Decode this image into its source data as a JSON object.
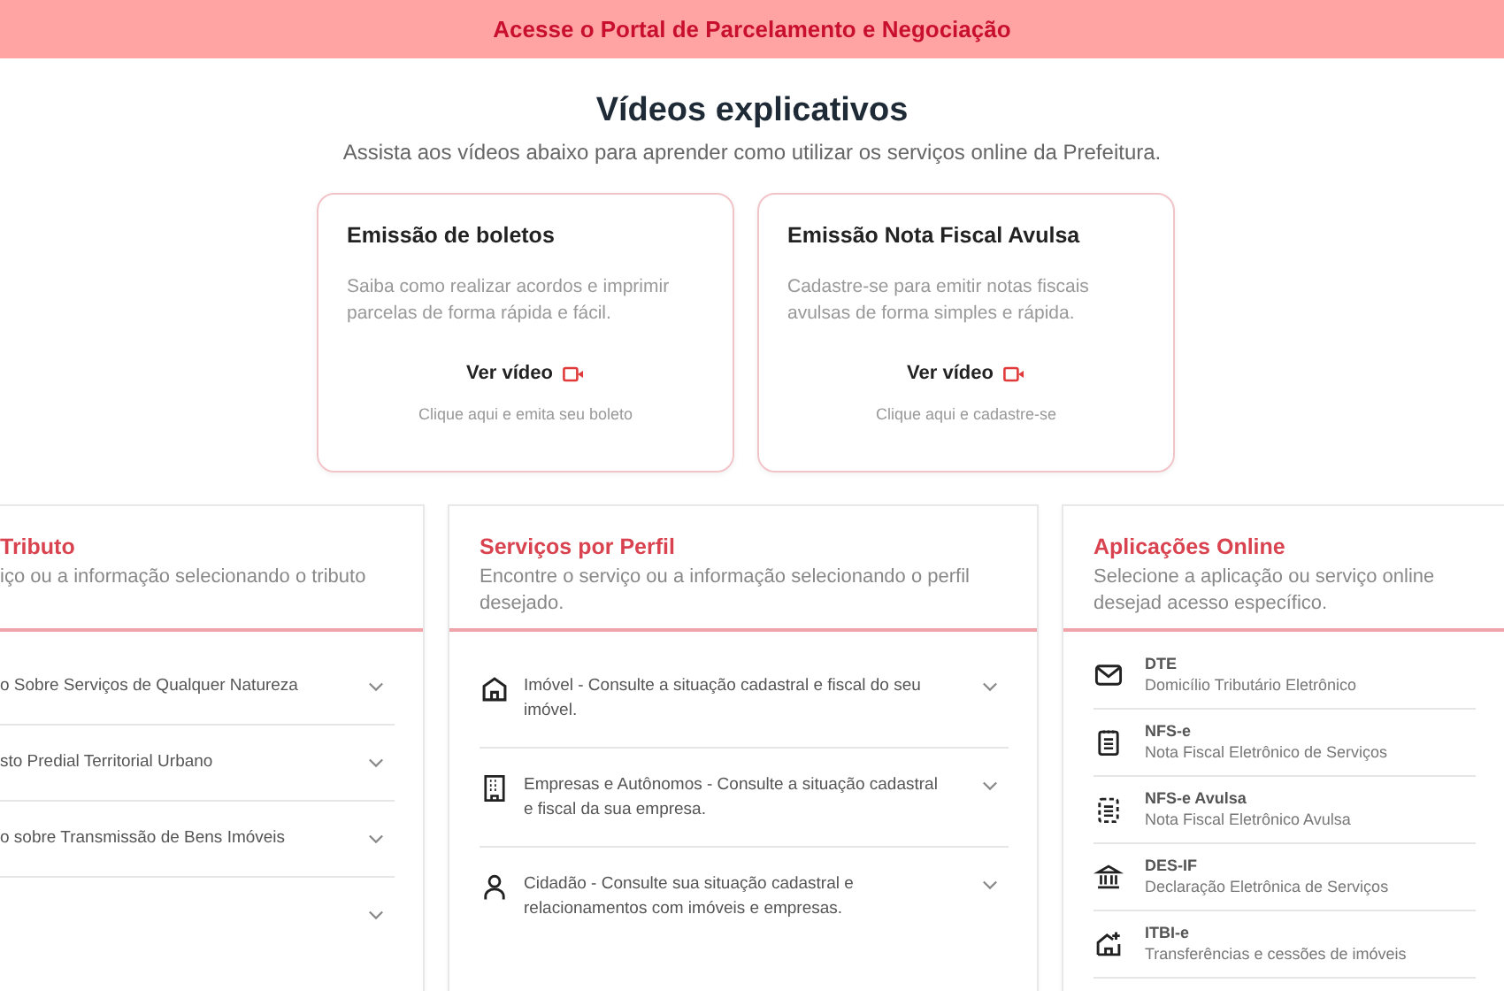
{
  "banner": {
    "text": "Acesse o Portal de Parcelamento e Negociação"
  },
  "videos": {
    "title": "Vídeos explicativos",
    "subtitle": "Assista aos vídeos abaixo para aprender como utilizar os serviços online da Prefeitura.",
    "cards": [
      {
        "title": "Emissão de boletos",
        "description": "Saiba como realizar acordos e imprimir parcelas de forma rápida e fácil.",
        "link": "Ver vídeo",
        "hint": "Clique aqui e emita seu boleto"
      },
      {
        "title": "Emissão Nota Fiscal Avulsa",
        "description": "Cadastre-se para emitir notas fiscais avulsas de forma simples e rápida.",
        "link": "Ver vídeo",
        "hint": "Clique aqui e cadastre-se"
      }
    ]
  },
  "panels": [
    {
      "title": "Tributo",
      "subtitle": "iço ou a informação selecionando o tributo",
      "kind": "accordion",
      "items": [
        {
          "label": "o Sobre Serviços de Qualquer Natureza",
          "expanded": false
        },
        {
          "label": "sto Predial Territorial Urbano",
          "expanded": false
        },
        {
          "label": "o sobre Transmissão de Bens Imóveis",
          "expanded": false
        },
        {
          "expanded": false
        }
      ]
    },
    {
      "title": "Serviços por Perfil",
      "subtitle": "Encontre o serviço ou a informação selecionando o perfil desejado.",
      "kind": "accordion",
      "items": [
        {
          "kind": "house",
          "label": "Imóvel - Consulte a situação cadastral e fiscal do seu imóvel.",
          "expanded": false
        },
        {
          "kind": "building",
          "label": "Empresas e Autônomos - Consulte a situação cadastral e fiscal da sua empresa.",
          "expanded": false
        },
        {
          "kind": "person",
          "label": "Cidadão - Consulte sua situação cadastral e relacionamentos com imóveis e empresas.",
          "expanded": false
        }
      ]
    },
    {
      "title": "Aplicações Online",
      "subtitle": "Selecione a aplicação ou serviço online desejad acesso específico.",
      "kind": "apps",
      "items": [
        {
          "kind": "mail",
          "name": "DTE",
          "description": "Domicílio Tributário Eletrônico"
        },
        {
          "kind": "document",
          "name": "NFS-e",
          "description": "Nota Fiscal Eletrônico de Serviços"
        },
        {
          "kind": "dashed-document",
          "name": "NFS-e Avulsa",
          "description": "Nota Fiscal Eletrônico Avulsa"
        },
        {
          "kind": "bank",
          "name": "DES-IF",
          "description": "Declaração Eletrônica de Serviços"
        },
        {
          "kind": "house-plus",
          "name": "ITBI-e",
          "description": "Transferências e cessões de imóveis"
        }
      ]
    }
  ]
}
